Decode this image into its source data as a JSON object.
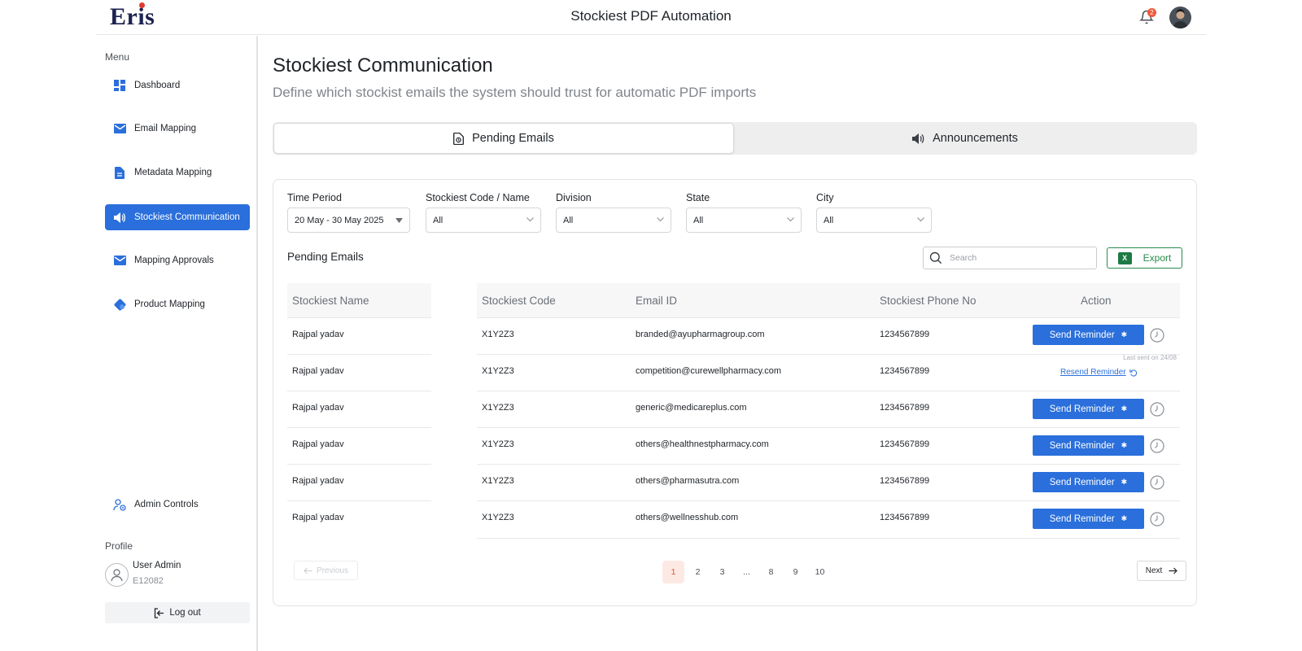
{
  "app": {
    "logo_text": "Eris",
    "title": "Stockiest PDF Automation",
    "notification_count": "2"
  },
  "sidebar": {
    "menu_heading": "Menu",
    "items": [
      {
        "label": "Dashboard",
        "icon": "dashboard-icon"
      },
      {
        "label": "Email Mapping",
        "icon": "mail-icon"
      },
      {
        "label": "Metadata Mapping",
        "icon": "document-icon"
      },
      {
        "label": "Stockiest Communication",
        "icon": "megaphone-icon",
        "active": true
      },
      {
        "label": "Mapping Approvals",
        "icon": "mail-icon"
      },
      {
        "label": "Product Mapping",
        "icon": "product-icon"
      }
    ],
    "admin_controls": "Admin Controls",
    "profile_heading": "Profile",
    "user_name": "User Admin",
    "user_id": "E12082",
    "logout": "Log out"
  },
  "page": {
    "title": "Stockiest Communication",
    "subtitle": "Define which stockist emails the system should trust for automatic PDF imports"
  },
  "tabs": [
    {
      "label": "Pending Emails",
      "active": true
    },
    {
      "label": "Announcements",
      "active": false
    }
  ],
  "filters": [
    {
      "label": "Time Period",
      "value": "20 May - 30 May 2025"
    },
    {
      "label": "Stockiest Code / Name",
      "value": "All"
    },
    {
      "label": "Division",
      "value": "All"
    },
    {
      "label": "State",
      "value": "All"
    },
    {
      "label": "City",
      "value": "All"
    }
  ],
  "table": {
    "title": "Pending Emails",
    "search_placeholder": "Search",
    "export_label": "Export",
    "headers": [
      "Stockiest Name",
      "Stockiest Code",
      "Email ID",
      "Stockiest Phone No",
      "Action"
    ],
    "rows": [
      {
        "name": "Rajpal yadav",
        "code": "X1Y2Z3",
        "email": "branded@ayupharmagroup.com",
        "phone": "1234567899",
        "action": "Send Reminder"
      },
      {
        "name": "Rajpal yadav",
        "code": "X1Y2Z3",
        "email": "competition@curewellpharmacy.com",
        "phone": "1234567899",
        "action": "Resend Reminder",
        "last_sent": "Last sent on 24/08"
      },
      {
        "name": "Rajpal yadav",
        "code": "X1Y2Z3",
        "email": "generic@medicareplus.com",
        "phone": "1234567899",
        "action": "Send Reminder"
      },
      {
        "name": "Rajpal yadav",
        "code": "X1Y2Z3",
        "email": "others@healthnestpharmacy.com",
        "phone": "1234567899",
        "action": "Send Reminder"
      },
      {
        "name": "Rajpal yadav",
        "code": "X1Y2Z3",
        "email": "others@pharmasutra.com",
        "phone": "1234567899",
        "action": "Send Reminder"
      },
      {
        "name": "Rajpal yadav",
        "code": "X1Y2Z3",
        "email": "others@wellnesshub.com",
        "phone": "1234567899",
        "action": "Send Reminder"
      }
    ]
  },
  "pagination": {
    "previous": "Previous",
    "next": "Next",
    "pages": [
      "1",
      "2",
      "3",
      "...",
      "8",
      "9",
      "10"
    ],
    "current": "1"
  },
  "colors": {
    "primary": "#2a6fdb",
    "export_green": "#2b8a4e",
    "badge": "#f05a3a",
    "page_active_bg": "#fde9e4"
  }
}
